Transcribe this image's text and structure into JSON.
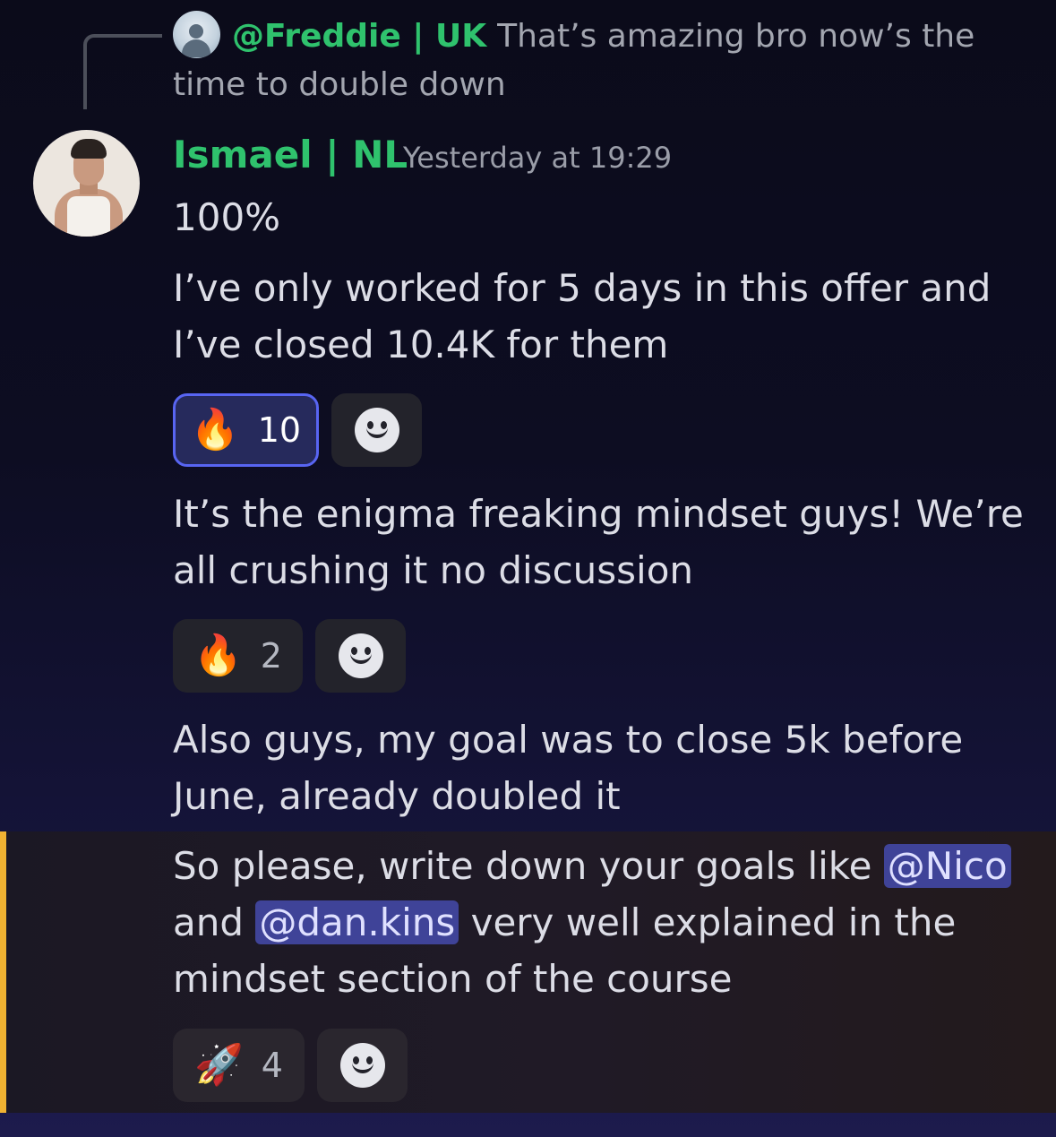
{
  "reply": {
    "author": "@Freddie | UK",
    "text": "That’s amazing bro now’s the time to double down"
  },
  "message": {
    "author": "Ismael | NL",
    "timestamp": "Yesterday at 19:29",
    "line1": "100%",
    "line2": "I’ve only worked for 5 days in this offer and I’ve closed 10.4K for them",
    "line3": "It’s the enigma freaking mindset guys!  We’re all crushing it no discussion",
    "line4": "Also guys, my goal was to close 5k before June, already doubled it",
    "line5_part1": "So please, write down your goals like ",
    "mention1": "@Nico",
    "line5_part2": " and ",
    "mention2": "@dan.kins",
    "line5_part3": " very well explained in the mindset section of the course"
  },
  "reactions": {
    "r1": {
      "emoji": "🔥",
      "count": "10",
      "icon": "fire-icon"
    },
    "r2": {
      "emoji": "🔥",
      "count": "2",
      "icon": "fire-icon"
    },
    "r3": {
      "emoji": "🚀",
      "count": "4",
      "icon": "rocket-icon"
    }
  },
  "colors": {
    "author": "#2fc26d",
    "mention_bg": "#3f4398",
    "highlight_bar": "#f0b232",
    "active_reaction_border": "#5865f2"
  }
}
